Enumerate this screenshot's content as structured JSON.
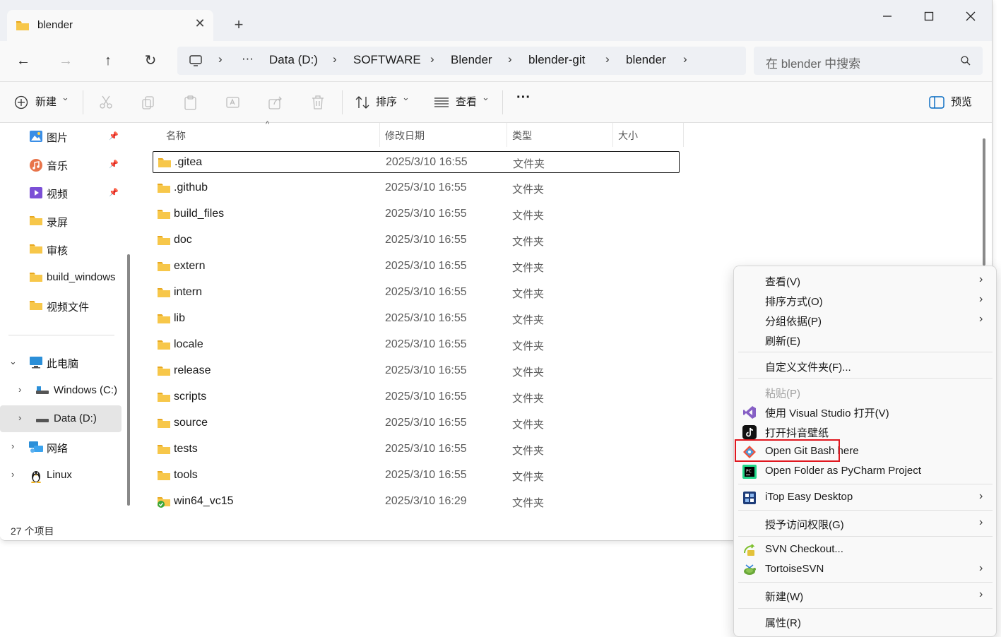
{
  "window": {
    "tab_title": "blender",
    "tab_close": "✕",
    "new_tab": "+",
    "minimize": "—",
    "maximize": "☐",
    "close": "✕"
  },
  "nav": {
    "back": "←",
    "forward": "→",
    "up": "↑",
    "refresh": "↻",
    "more": "···",
    "breadcrumb": [
      "Data (D:)",
      "SOFTWARE",
      "Blender",
      "blender-git",
      "blender"
    ],
    "sep": "›",
    "search_placeholder": "在 blender 中搜索"
  },
  "toolbar": {
    "new_label": "新建",
    "sort_label": "排序",
    "view_label": "查看",
    "more": "···",
    "preview_label": "预览",
    "dropdown": "⌄"
  },
  "sidebar": {
    "quick": [
      {
        "label": "图片",
        "icon": "pictures-icon",
        "pinned": true
      },
      {
        "label": "音乐",
        "icon": "music-icon",
        "pinned": true
      },
      {
        "label": "视频",
        "icon": "videos-icon",
        "pinned": true
      },
      {
        "label": "录屏",
        "icon": "folder-icon",
        "pinned": false
      },
      {
        "label": "审核",
        "icon": "folder-icon",
        "pinned": false
      },
      {
        "label": "build_windows",
        "icon": "folder-icon",
        "pinned": false
      },
      {
        "label": "视频文件",
        "icon": "folder-icon",
        "pinned": false
      }
    ],
    "this_pc": "此电脑",
    "drives": [
      "Windows (C:)",
      "Data (D:)"
    ],
    "network": "网络",
    "linux": "Linux",
    "pin_glyph": "📌",
    "expand": "›",
    "collapse": "⌄"
  },
  "list": {
    "columns": {
      "name": "名称",
      "modified": "修改日期",
      "type": "类型",
      "size": "大小"
    },
    "sort_indicator": "^",
    "rows": [
      {
        "name": ".gitea",
        "modified": "2025/3/10 16:55",
        "type": "文件夹"
      },
      {
        "name": ".github",
        "modified": "2025/3/10 16:55",
        "type": "文件夹"
      },
      {
        "name": "build_files",
        "modified": "2025/3/10 16:55",
        "type": "文件夹"
      },
      {
        "name": "doc",
        "modified": "2025/3/10 16:55",
        "type": "文件夹"
      },
      {
        "name": "extern",
        "modified": "2025/3/10 16:55",
        "type": "文件夹"
      },
      {
        "name": "intern",
        "modified": "2025/3/10 16:55",
        "type": "文件夹"
      },
      {
        "name": "lib",
        "modified": "2025/3/10 16:55",
        "type": "文件夹"
      },
      {
        "name": "locale",
        "modified": "2025/3/10 16:55",
        "type": "文件夹"
      },
      {
        "name": "release",
        "modified": "2025/3/10 16:55",
        "type": "文件夹"
      },
      {
        "name": "scripts",
        "modified": "2025/3/10 16:55",
        "type": "文件夹"
      },
      {
        "name": "source",
        "modified": "2025/3/10 16:55",
        "type": "文件夹"
      },
      {
        "name": "tests",
        "modified": "2025/3/10 16:55",
        "type": "文件夹"
      },
      {
        "name": "tools",
        "modified": "2025/3/10 16:55",
        "type": "文件夹"
      },
      {
        "name": "win64_vc15",
        "modified": "2025/3/10 16:29",
        "type": "文件夹"
      }
    ]
  },
  "status": {
    "item_count": "27 个项目"
  },
  "context_menu": {
    "chevron": "›",
    "items": {
      "view": "查看(V)",
      "sort_by": "排序方式(O)",
      "group_by": "分组依据(P)",
      "refresh": "刷新(E)",
      "customize": "自定义文件夹(F)...",
      "paste": "粘贴(P)",
      "open_vs": "使用 Visual Studio 打开(V)",
      "douyin": "打开抖音壁纸",
      "git_bash": "Open Git Bash here",
      "pycharm": "Open Folder as PyCharm Project",
      "itop": "iTop Easy Desktop",
      "access": "授予访问权限(G)",
      "svn_checkout": "SVN Checkout...",
      "tortoise": "TortoiseSVN",
      "new": "新建(W)",
      "properties": "属性(R)"
    }
  },
  "colors": {
    "folder": "#f7c74a",
    "highlight": "#e0171f",
    "accent": "#0067c0"
  }
}
